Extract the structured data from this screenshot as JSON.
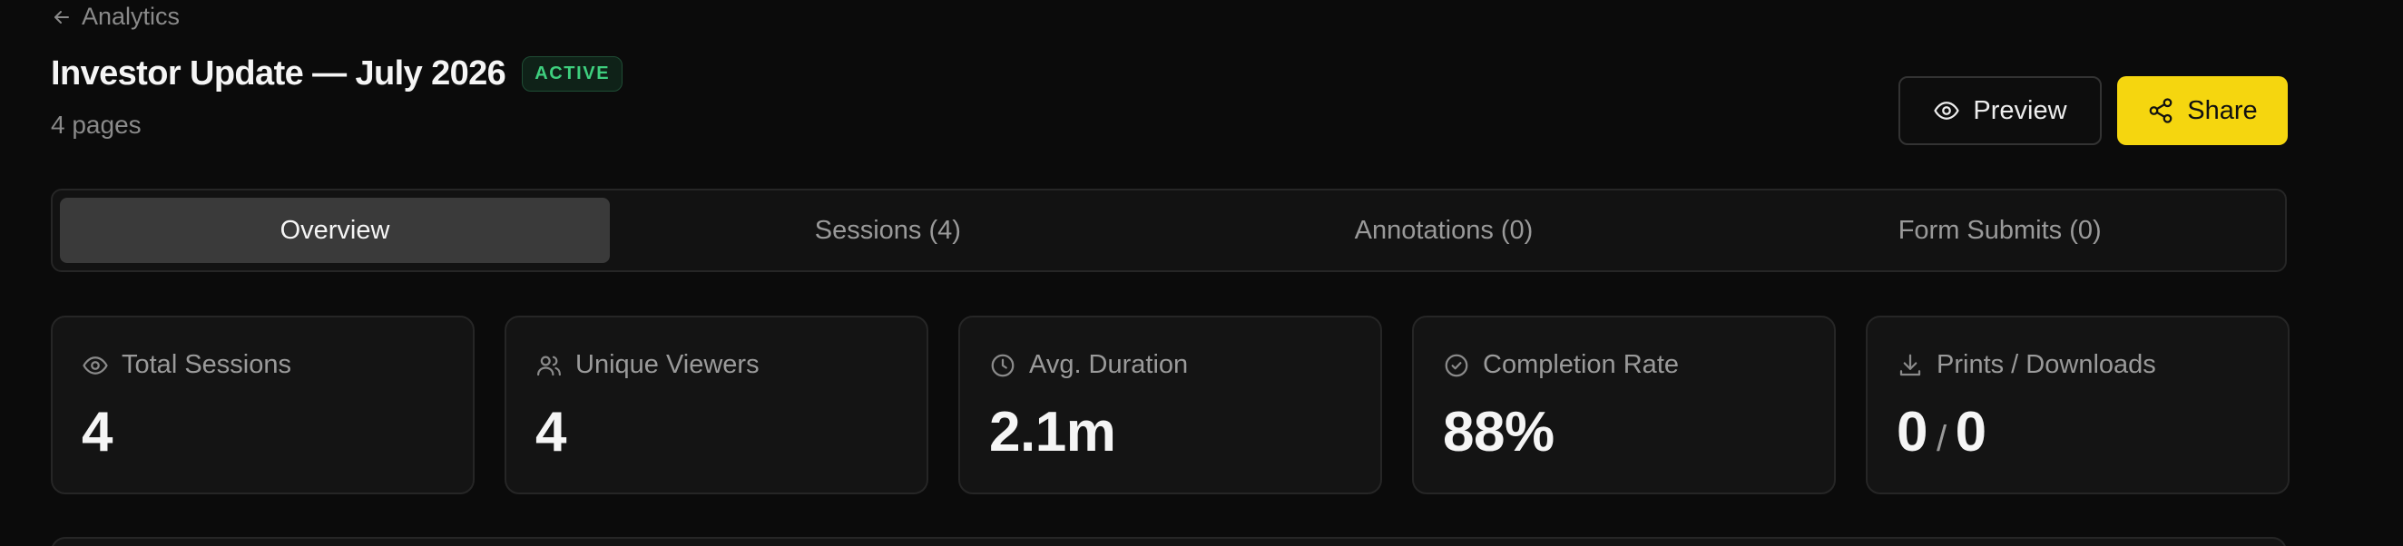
{
  "nav": {
    "back_label": "Analytics"
  },
  "header": {
    "title": "Investor Update — July 2026",
    "status": "ACTIVE",
    "page_count": "4 pages"
  },
  "actions": {
    "preview_label": "Preview",
    "share_label": "Share"
  },
  "tabs": [
    {
      "label": "Overview",
      "active": true
    },
    {
      "label": "Sessions (4)",
      "active": false
    },
    {
      "label": "Annotations (0)",
      "active": false
    },
    {
      "label": "Form Submits (0)",
      "active": false
    }
  ],
  "stats": [
    {
      "icon": "eye-icon",
      "label": "Total Sessions",
      "value": "4"
    },
    {
      "icon": "users-icon",
      "label": "Unique Viewers",
      "value": "4"
    },
    {
      "icon": "clock-icon",
      "label": "Avg. Duration",
      "value": "2.1m"
    },
    {
      "icon": "check-circle-icon",
      "label": "Completion Rate",
      "value": "88%"
    },
    {
      "icon": "download-icon",
      "label": "Prints / Downloads",
      "value_left": "0",
      "separator": "/",
      "value_right": "0"
    }
  ],
  "colors": {
    "accent": "#f5d60f",
    "active_badge": "#3ecf7e",
    "background": "#0b0b0b"
  }
}
